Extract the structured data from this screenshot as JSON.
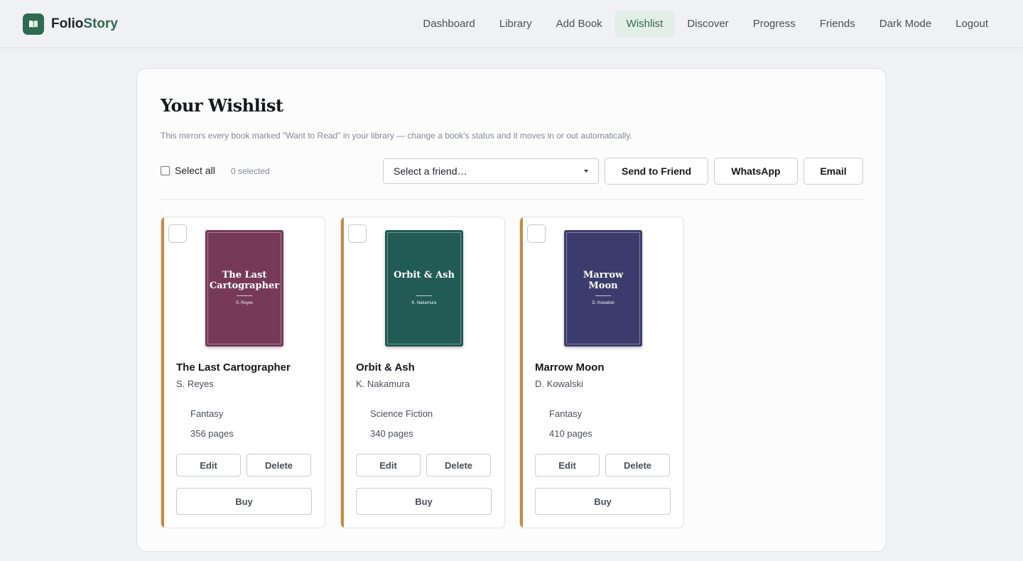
{
  "brand": {
    "name_main": "Folio",
    "name_accent": "Story",
    "logo_icon": "open-book-icon"
  },
  "nav": {
    "items": [
      "Dashboard",
      "Library",
      "Add Book",
      "Wishlist",
      "Discover",
      "Progress",
      "Friends",
      "Dark Mode",
      "Logout"
    ],
    "active": "Wishlist"
  },
  "page": {
    "title": "Your Wishlist",
    "subtitle": "This mirrors every book marked \"Want to Read\" in your library — change a book's status and it moves in or out automatically."
  },
  "toolbar": {
    "select_all_label": "Select all",
    "selected_count": "0 selected",
    "friend_select_value": "Select a friend…",
    "send_label": "Send to Friend",
    "whatsapp_label": "WhatsApp",
    "email_label": "Email"
  },
  "books": [
    {
      "title": "The Last Cartographer",
      "cover_title": "The Last Cartographer",
      "author": "S. Reyes",
      "genre": "Fantasy",
      "pages": "356 pages",
      "cover_color": "#763a58"
    },
    {
      "title": "Orbit & Ash",
      "cover_title": "Orbit & Ash",
      "author": "K. Nakamura",
      "genre": "Science Fiction",
      "pages": "340 pages",
      "cover_color": "#225a56"
    },
    {
      "title": "Marrow Moon",
      "cover_title": "Marrow Moon",
      "author": "D. Kowalski",
      "genre": "Fantasy",
      "pages": "410 pages",
      "cover_color": "#3c3c6c"
    }
  ],
  "book_actions": {
    "edit": "Edit",
    "delete": "Delete",
    "buy": "Buy"
  },
  "colors": {
    "brand": "#2f6b4f",
    "accent_stripe": "#c9893d",
    "active_nav_bg": "#e3eee7"
  }
}
